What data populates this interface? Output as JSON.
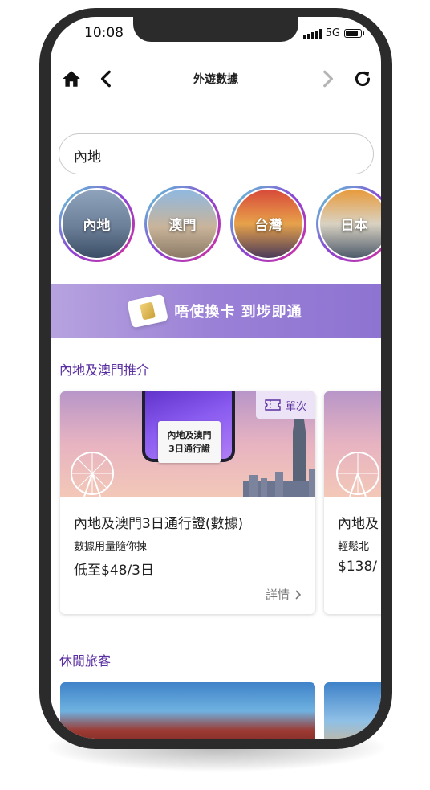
{
  "status_bar": {
    "time": "10:08",
    "network": "5G"
  },
  "navbar": {
    "title": "外遊數據"
  },
  "search": {
    "value": "內地"
  },
  "regions": [
    {
      "label": "內地"
    },
    {
      "label": "澳門"
    },
    {
      "label": "台灣"
    },
    {
      "label": "日本"
    }
  ],
  "banner": {
    "text": "唔使換卡  到埗即通"
  },
  "recommend_section": {
    "title": "內地及澳門推介"
  },
  "cards": [
    {
      "image_text_line1": "內地及澳門",
      "image_text_line2": "3日通行證",
      "badge": "單次",
      "title": "內地及澳門3日通行證(數據)",
      "subtitle": "數據用量隨你揀",
      "price": "低至$48/3日",
      "detail": "詳情"
    },
    {
      "title": "內地及",
      "subtitle": "輕鬆北",
      "price": "$138/"
    }
  ],
  "leisure_section": {
    "title": "休閒旅客"
  },
  "colors": {
    "accent_purple": "#5a2fa0",
    "banner_purple": "#9a80d6",
    "phone_frame": "#2b2b2b"
  }
}
